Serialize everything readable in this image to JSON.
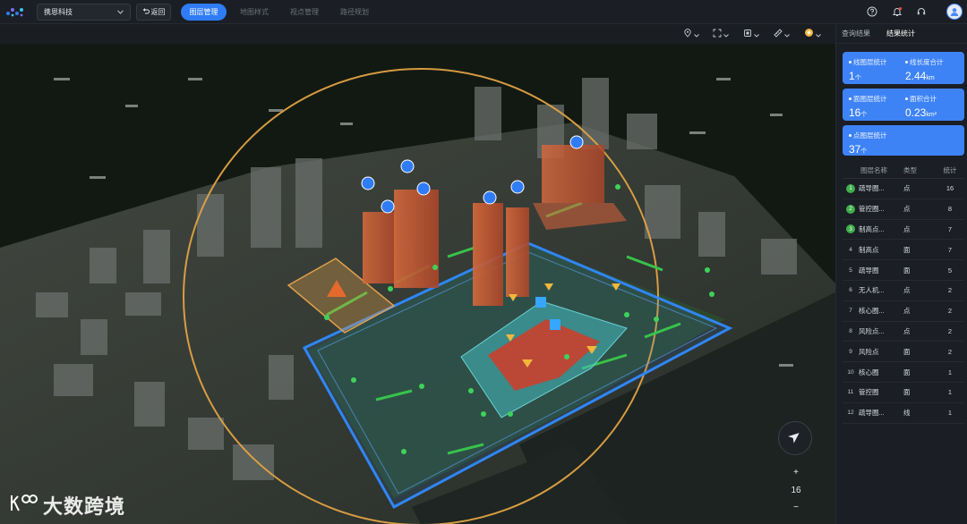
{
  "header": {
    "company": "携恩科技",
    "back_label": "返回",
    "tabs": [
      {
        "label": "图层管理",
        "active": true
      },
      {
        "label": "地图样式",
        "active": false
      },
      {
        "label": "视点管理",
        "active": false
      },
      {
        "label": "路径规划",
        "active": false
      }
    ],
    "icons": [
      "help-icon",
      "bell-icon",
      "headset-icon",
      "user-icon"
    ]
  },
  "map": {
    "toolbar_icons": [
      "location-pin-icon",
      "fullscreen-icon",
      "layers-icon",
      "ruler-icon",
      "sun-icon"
    ],
    "zoom_in": "+",
    "zoom_level": "16",
    "zoom_out": "−",
    "watermark": "大数跨境"
  },
  "panel": {
    "tabs": [
      {
        "label": "查询结果",
        "active": false
      },
      {
        "label": "结果统计",
        "active": true
      }
    ],
    "cards": [
      {
        "items": [
          {
            "label": "线图层统计",
            "value": "1",
            "unit": "个"
          },
          {
            "label": "线长度合计",
            "value": "2.44",
            "unit": "km"
          }
        ]
      },
      {
        "items": [
          {
            "label": "面图层统计",
            "value": "16",
            "unit": "个"
          },
          {
            "label": "面积合计",
            "value": "0.23",
            "unit": "km²"
          }
        ]
      },
      {
        "items": [
          {
            "label": "点图层统计",
            "value": "37",
            "unit": "个"
          }
        ]
      }
    ],
    "table_headers": [
      "图层名称",
      "类型",
      "统计"
    ],
    "rows": [
      {
        "idx": "1",
        "name": "疏导圈...",
        "type": "点",
        "count": "16"
      },
      {
        "idx": "2",
        "name": "管控圈...",
        "type": "点",
        "count": "8"
      },
      {
        "idx": "3",
        "name": "制高点...",
        "type": "点",
        "count": "7"
      },
      {
        "idx": "4",
        "name": "制高点",
        "type": "面",
        "count": "7"
      },
      {
        "idx": "5",
        "name": "疏导圈",
        "type": "面",
        "count": "5"
      },
      {
        "idx": "6",
        "name": "无人机...",
        "type": "点",
        "count": "2"
      },
      {
        "idx": "7",
        "name": "核心圈...",
        "type": "点",
        "count": "2"
      },
      {
        "idx": "8",
        "name": "风险点...",
        "type": "点",
        "count": "2"
      },
      {
        "idx": "9",
        "name": "风险点",
        "type": "面",
        "count": "2"
      },
      {
        "idx": "10",
        "name": "核心圈",
        "type": "面",
        "count": "1"
      },
      {
        "idx": "11",
        "name": "管控圈",
        "type": "面",
        "count": "1"
      },
      {
        "idx": "12",
        "name": "疏导圈...",
        "type": "线",
        "count": "1"
      }
    ]
  }
}
